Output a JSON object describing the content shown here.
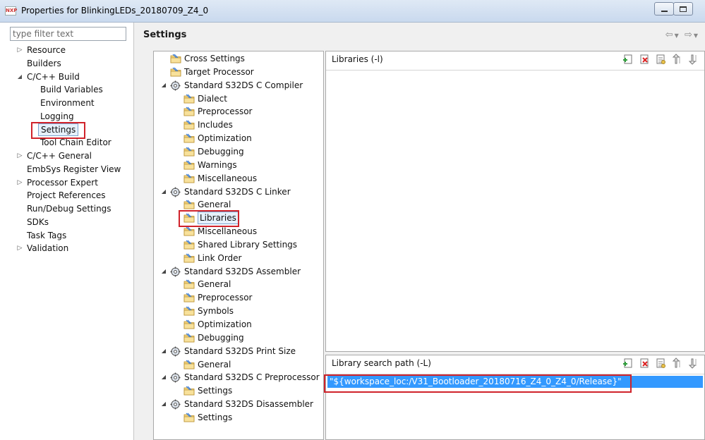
{
  "window": {
    "title": "Properties for BlinkingLEDs_20180709_Z4_0",
    "app_icon_text": "NXP"
  },
  "left_tree": {
    "filter_placeholder": "type filter text",
    "items": [
      {
        "label": "Resource",
        "twisty": "closed",
        "level": 0
      },
      {
        "label": "Builders",
        "twisty": "none",
        "level": 0
      },
      {
        "label": "C/C++ Build",
        "twisty": "open",
        "level": 0
      },
      {
        "label": "Build Variables",
        "twisty": "none",
        "level": 1
      },
      {
        "label": "Environment",
        "twisty": "none",
        "level": 1
      },
      {
        "label": "Logging",
        "twisty": "none",
        "level": 1
      },
      {
        "label": "Settings",
        "twisty": "none",
        "level": 1,
        "selected": true
      },
      {
        "label": "Tool Chain Editor",
        "twisty": "none",
        "level": 1
      },
      {
        "label": "C/C++ General",
        "twisty": "closed",
        "level": 0
      },
      {
        "label": "EmbSys Register View",
        "twisty": "none",
        "level": 0
      },
      {
        "label": "Processor Expert",
        "twisty": "closed",
        "level": 0
      },
      {
        "label": "Project References",
        "twisty": "none",
        "level": 0
      },
      {
        "label": "Run/Debug Settings",
        "twisty": "none",
        "level": 0
      },
      {
        "label": "SDKs",
        "twisty": "none",
        "level": 0
      },
      {
        "label": "Task Tags",
        "twisty": "none",
        "level": 0
      },
      {
        "label": "Validation",
        "twisty": "closed",
        "level": 0
      }
    ]
  },
  "header": {
    "title": "Settings"
  },
  "tool_tree": {
    "items": [
      {
        "label": "Cross Settings",
        "icon": "folder",
        "level": 0
      },
      {
        "label": "Target Processor",
        "icon": "folder",
        "level": 0
      },
      {
        "label": "Standard S32DS C Compiler",
        "icon": "gear",
        "level": 0,
        "open": true
      },
      {
        "label": "Dialect",
        "icon": "folder",
        "level": 1
      },
      {
        "label": "Preprocessor",
        "icon": "folder",
        "level": 1
      },
      {
        "label": "Includes",
        "icon": "folder",
        "level": 1
      },
      {
        "label": "Optimization",
        "icon": "folder",
        "level": 1
      },
      {
        "label": "Debugging",
        "icon": "folder",
        "level": 1
      },
      {
        "label": "Warnings",
        "icon": "folder",
        "level": 1
      },
      {
        "label": "Miscellaneous",
        "icon": "folder",
        "level": 1
      },
      {
        "label": "Standard S32DS C Linker",
        "icon": "gear",
        "level": 0,
        "open": true
      },
      {
        "label": "General",
        "icon": "folder",
        "level": 1
      },
      {
        "label": "Libraries",
        "icon": "folder",
        "level": 1,
        "selected": true
      },
      {
        "label": "Miscellaneous",
        "icon": "folder",
        "level": 1
      },
      {
        "label": "Shared Library Settings",
        "icon": "folder",
        "level": 1
      },
      {
        "label": "Link Order",
        "icon": "folder",
        "level": 1
      },
      {
        "label": "Standard S32DS Assembler",
        "icon": "gear",
        "level": 0,
        "open": true
      },
      {
        "label": "General",
        "icon": "folder",
        "level": 1
      },
      {
        "label": "Preprocessor",
        "icon": "folder",
        "level": 1
      },
      {
        "label": "Symbols",
        "icon": "folder",
        "level": 1
      },
      {
        "label": "Optimization",
        "icon": "folder",
        "level": 1
      },
      {
        "label": "Debugging",
        "icon": "folder",
        "level": 1
      },
      {
        "label": "Standard S32DS Print Size",
        "icon": "gear",
        "level": 0,
        "open": true
      },
      {
        "label": "General",
        "icon": "folder",
        "level": 1
      },
      {
        "label": "Standard S32DS C Preprocessor",
        "icon": "gear",
        "level": 0,
        "open": true
      },
      {
        "label": "Settings",
        "icon": "folder",
        "level": 1
      },
      {
        "label": "Standard S32DS Disassembler",
        "icon": "gear",
        "level": 0,
        "open": true
      },
      {
        "label": "Settings",
        "icon": "folder",
        "level": 1
      }
    ]
  },
  "libraries_group": {
    "title": "Libraries (-l)",
    "items": []
  },
  "library_path_group": {
    "title": "Library search path (-L)",
    "items": [
      "\"${workspace_loc:/V31_Bootloader_20180716_Z4_0_Z4_0/Release}\""
    ]
  },
  "toolbar_icons": [
    "add-icon",
    "delete-icon",
    "edit-icon",
    "move-up-icon",
    "move-down-icon"
  ],
  "colors": {
    "highlight": "#d0232b",
    "selection": "#3399ff"
  }
}
